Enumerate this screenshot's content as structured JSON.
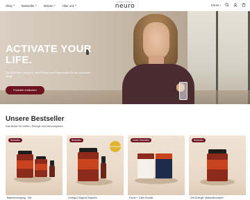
{
  "nav": {
    "links": [
      {
        "label": "Shop",
        "has_menu": true
      },
      {
        "label": "Bestseller",
        "has_menu": true
      },
      {
        "label": "Wissen",
        "has_menu": true
      },
      {
        "label": "Über uns",
        "has_menu": true
      }
    ],
    "logo_top": "INSTITUT",
    "logo_main": "neuro",
    "right": {
      "menu_label": "Konto",
      "icons": [
        "search-icon",
        "user-icon",
        "cart-icon"
      ]
    }
  },
  "hero": {
    "title_line1": "ACTIVATE YOUR",
    "title_line2": "LIFE.",
    "subtitle": "Die effektivste Lösung für mehr Energie und Regeneration für den modernen Alltag",
    "cta_label": "Produkte entdecken"
  },
  "bestseller": {
    "title": "Unsere Bestseller",
    "subtitle": "Das Beste für Gehirn, Energie und Immunsystem",
    "cards": [
      {
        "badge": "Bestseller",
        "name": "Basisversorgung · Set"
      },
      {
        "badge": "Bestseller",
        "name": "Omega-3 Algenöl Kapseln",
        "seal": "TESTSIEGER"
      },
      {
        "badge": "Gratis Geschenk",
        "name": "Focus + Calm Bundle"
      },
      {
        "badge": "Bestseller",
        "name": "Zell-Energie Vitalstoffkomplex"
      }
    ]
  },
  "colors": {
    "accent": "#6e1420",
    "hero_bg": "#c9bcaa",
    "card_bg": "#ebdccb"
  }
}
